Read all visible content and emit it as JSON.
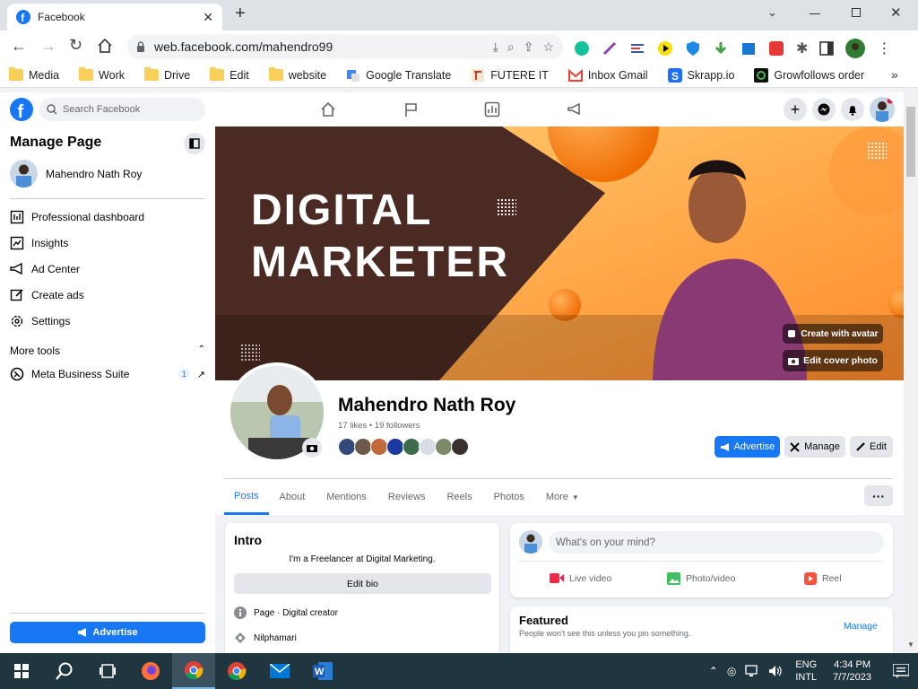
{
  "browser": {
    "tab_title": "Facebook",
    "url": "web.facebook.com/mahendro99",
    "bookmarks": [
      "Media",
      "Work",
      "Drive",
      "Edit",
      "website",
      "Google Translate",
      "FUTERE IT",
      "Inbox Gmail",
      "Skrapp.io",
      "Growfollows order"
    ]
  },
  "fb": {
    "search_placeholder": "Search Facebook"
  },
  "sidebar": {
    "title": "Manage Page",
    "page_name": "Mahendro Nath Roy",
    "items": [
      {
        "label": "Professional dashboard"
      },
      {
        "label": "Insights"
      },
      {
        "label": "Ad Center"
      },
      {
        "label": "Create ads"
      },
      {
        "label": "Settings"
      }
    ],
    "more_tools": "More tools",
    "meta_suite": "Meta Business Suite",
    "meta_badge": "1",
    "advertise": "Advertise"
  },
  "cover": {
    "line1": "DIGITAL",
    "line2": "MARKETER",
    "create_avatar": "Create with avatar",
    "edit_cover": "Edit cover photo"
  },
  "profile": {
    "name": "Mahendro Nath Roy",
    "stats": "17 likes • 19 followers",
    "advertise": "Advertise",
    "manage": "Manage",
    "edit": "Edit"
  },
  "tabs": [
    "Posts",
    "About",
    "Mentions",
    "Reviews",
    "Reels",
    "Photos",
    "More"
  ],
  "intro": {
    "title": "Intro",
    "bio": "I'm a Freelancer at Digital Marketing.",
    "edit_bio": "Edit bio",
    "category": "Page · Digital creator",
    "location": "Nilphamari"
  },
  "composer": {
    "placeholder": "What's on your mind?",
    "live": "Live video",
    "photo": "Photo/video",
    "reel": "Reel"
  },
  "featured": {
    "title": "Featured",
    "subtitle": "People won't see this unless you pin something.",
    "manage": "Manage"
  },
  "taskbar": {
    "lang1": "ENG",
    "lang2": "INTL",
    "time": "4:34 PM",
    "date": "7/7/2023"
  },
  "colors": {
    "fb_blue": "#1877f2",
    "cover_dark": "#4a2a22",
    "cover_orange": "#ff9a3c"
  }
}
